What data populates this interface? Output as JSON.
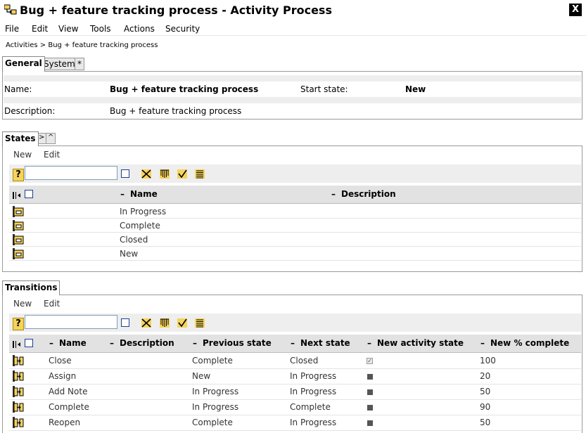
{
  "window": {
    "title": "Bug + feature tracking process - Activity Process",
    "close_label": "X"
  },
  "menu": [
    "File",
    "Edit",
    "View",
    "Tools",
    "Actions",
    "Security"
  ],
  "breadcrumb": "Activities > Bug + feature tracking process",
  "tabs": {
    "general": "General",
    "system": "System",
    "star": "*"
  },
  "general": {
    "name_label": "Name:",
    "name_value": "Bug + feature tracking process",
    "start_state_label": "Start state:",
    "start_state_value": "New",
    "description_label": "Description:",
    "description_value": "Bug + feature tracking process"
  },
  "states": {
    "tab_label": "States",
    "next_label": ">",
    "up_label": "^",
    "new_label": "New",
    "edit_label": "Edit",
    "filter_value": "",
    "help_glyph": "?",
    "columns": [
      "Name",
      "Description"
    ],
    "rows": [
      {
        "name": "In Progress",
        "description": ""
      },
      {
        "name": "Complete",
        "description": ""
      },
      {
        "name": "Closed",
        "description": ""
      },
      {
        "name": "New",
        "description": ""
      }
    ]
  },
  "transitions": {
    "tab_label": "Transitions",
    "new_label": "New",
    "edit_label": "Edit",
    "filter_value": "",
    "help_glyph": "?",
    "columns": [
      "Name",
      "Description",
      "Previous state",
      "Next state",
      "New activity state",
      "New % complete"
    ],
    "rows": [
      {
        "name": "Close",
        "description": "",
        "previous": "Complete",
        "next": "Closed",
        "activity_state": "checked",
        "percent": "100"
      },
      {
        "name": "Assign",
        "description": "",
        "previous": "New",
        "next": "In Progress",
        "activity_state": "filled",
        "percent": "20"
      },
      {
        "name": "Add Note",
        "description": "",
        "previous": "In Progress",
        "next": "In Progress",
        "activity_state": "filled",
        "percent": "50"
      },
      {
        "name": "Complete",
        "description": "",
        "previous": "In Progress",
        "next": "Complete",
        "activity_state": "filled",
        "percent": "90"
      },
      {
        "name": "Reopen",
        "description": "",
        "previous": "Complete",
        "next": "In Progress",
        "activity_state": "filled",
        "percent": "50"
      }
    ]
  },
  "icons": {
    "app": "process-icon",
    "toolbar": [
      "clear-filter-icon",
      "filter-icon",
      "select-all-icon",
      "list-view-icon"
    ],
    "state_row": "state-icon",
    "transition_row": "transition-icon"
  },
  "colors": {
    "icon_yellow": "#f6d35a",
    "header_gray": "#e2e2e2",
    "toolbar_gray": "#eeeeee",
    "checkbox_blue": "#1c3f95"
  }
}
